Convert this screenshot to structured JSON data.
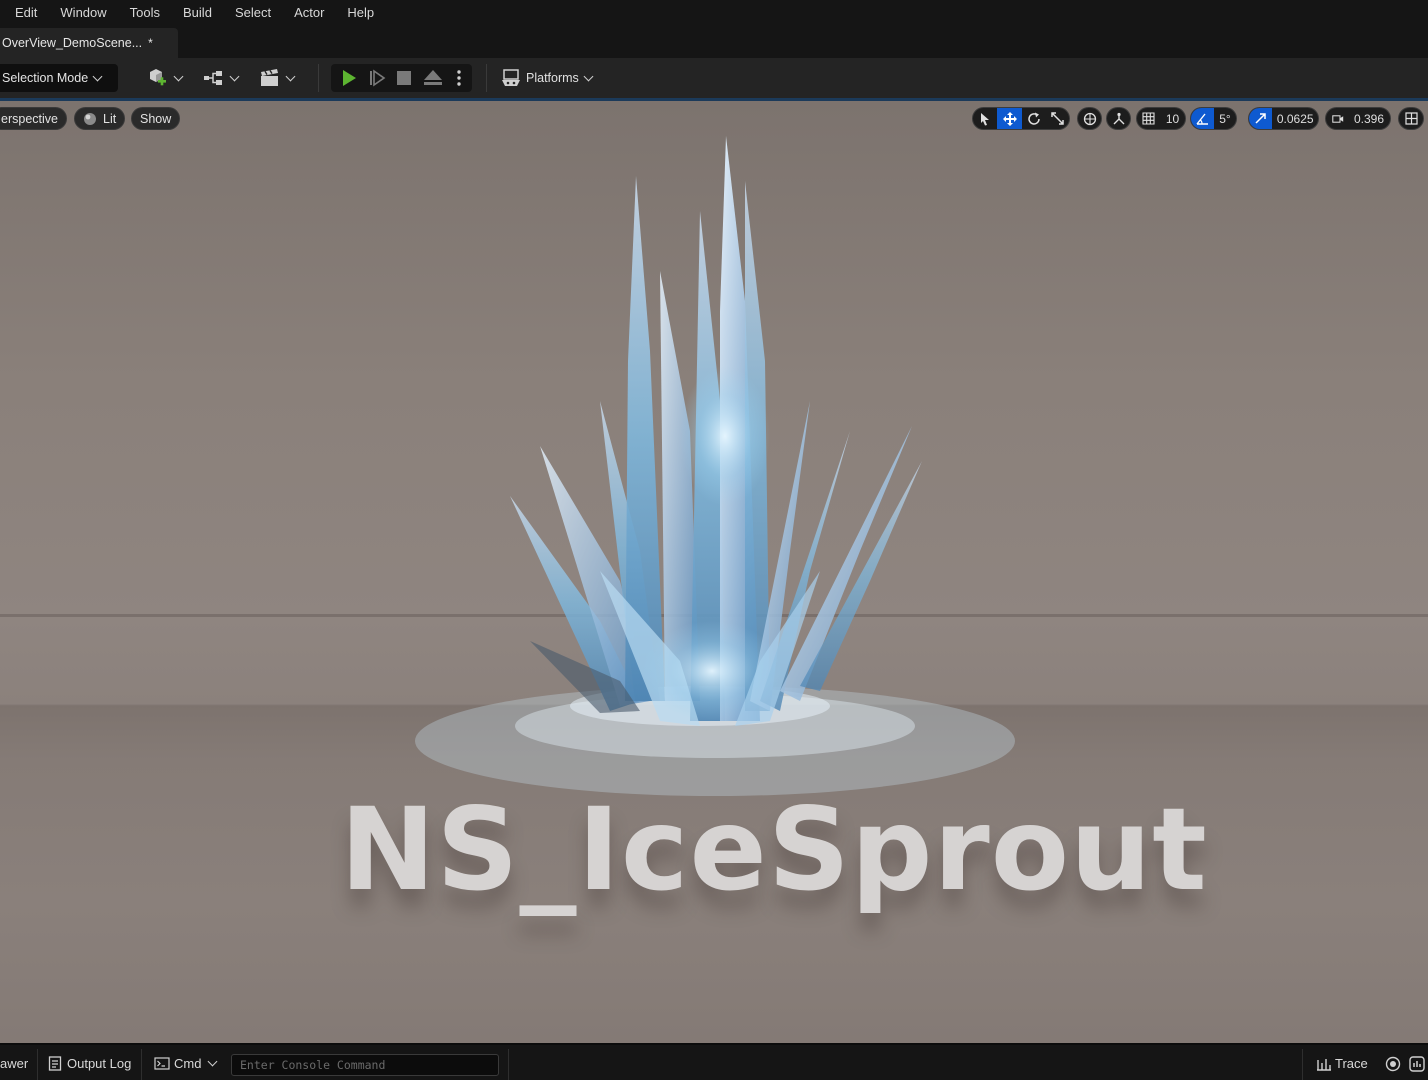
{
  "menu": {
    "items": [
      "Edit",
      "Window",
      "Tools",
      "Build",
      "Select",
      "Actor",
      "Help"
    ]
  },
  "tab": {
    "title": "OverView_DemoScene...",
    "dirty_marker": "*"
  },
  "toolbar": {
    "mode_label": "Selection Mode",
    "platforms_label": "Platforms",
    "icons": [
      "add-actor-icon",
      "blueprint-icon",
      "cinematics-icon",
      "play-icon",
      "advance-frame-icon",
      "stop-icon",
      "eject-icon",
      "more-options-icon",
      "platforms-icon"
    ],
    "play_color": "#5db531"
  },
  "viewport": {
    "perspective_label": "erspective",
    "lit_label": "Lit",
    "show_label": "Show",
    "grid_snap_value": "10",
    "rotation_snap_value": "5°",
    "scale_snap_value": "0.0625",
    "camera_speed_value": "0.396",
    "scene_text": "NS_IceSprout",
    "accent_color": "#0e5ad0"
  },
  "statusbar": {
    "drawer_label": "awer",
    "output_log_label": "Output Log",
    "cmd_label": "Cmd",
    "console_placeholder": "Enter Console Command",
    "trace_label": "Trace"
  }
}
